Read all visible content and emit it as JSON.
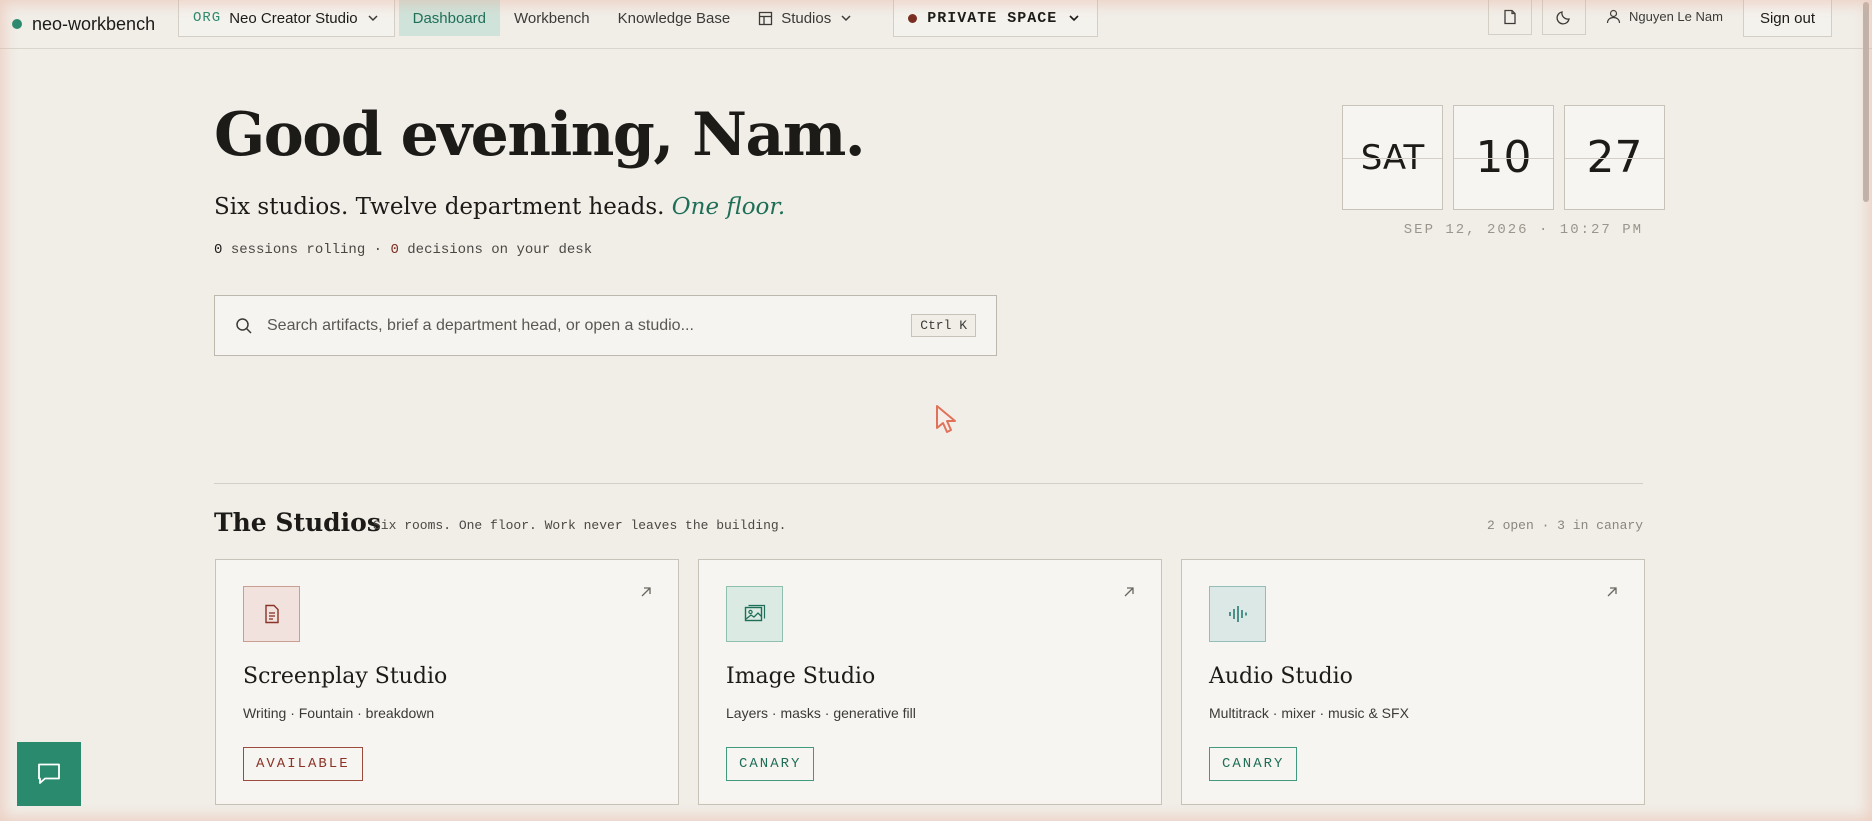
{
  "nav": {
    "brand": "neo-workbench",
    "org_tag": "ORG",
    "org_name": "Neo Creator Studio",
    "links": [
      "Dashboard",
      "Workbench",
      "Knowledge Base",
      "Studios"
    ],
    "space": "PRIVATE SPACE",
    "user": "Nguyen Le Nam",
    "signout": "Sign out"
  },
  "hero": {
    "greeting": "Good evening, Nam.",
    "tagline": "Six studios. Twelve department heads.",
    "tagline_em": "One floor.",
    "sessions_count": "0",
    "sessions_label": "sessions rolling",
    "sep": "·",
    "decisions_count": "0",
    "decisions_label": "decisions on your desk"
  },
  "search": {
    "placeholder": "Search artifacts, brief a department head, or open a studio...",
    "shortcut": "Ctrl K"
  },
  "clock": {
    "day": "SAT",
    "hour": "10",
    "minute": "27",
    "date_line": "SEP 12, 2026 · 10:27 PM"
  },
  "studios": {
    "title": "The Studios",
    "subtitle": "Six rooms. One floor. Work never leaves the building.",
    "meta": "2 open · 3 in canary",
    "cards": [
      {
        "name": "Screenplay Studio",
        "desc": "Writing · Fountain · breakdown",
        "badge": "AVAILABLE",
        "icon": "document-icon"
      },
      {
        "name": "Image Studio",
        "desc": "Layers · masks · generative fill",
        "badge": "CANARY",
        "icon": "image-icon"
      },
      {
        "name": "Audio Studio",
        "desc": "Multitrack · mixer · music & SFX",
        "badge": "CANARY",
        "icon": "waveform-icon"
      }
    ]
  },
  "colors": {
    "background": "#f1eee8",
    "accent_green": "#1f6f58",
    "accent_red": "#7a2e22",
    "fab": "#2a8a6d"
  }
}
